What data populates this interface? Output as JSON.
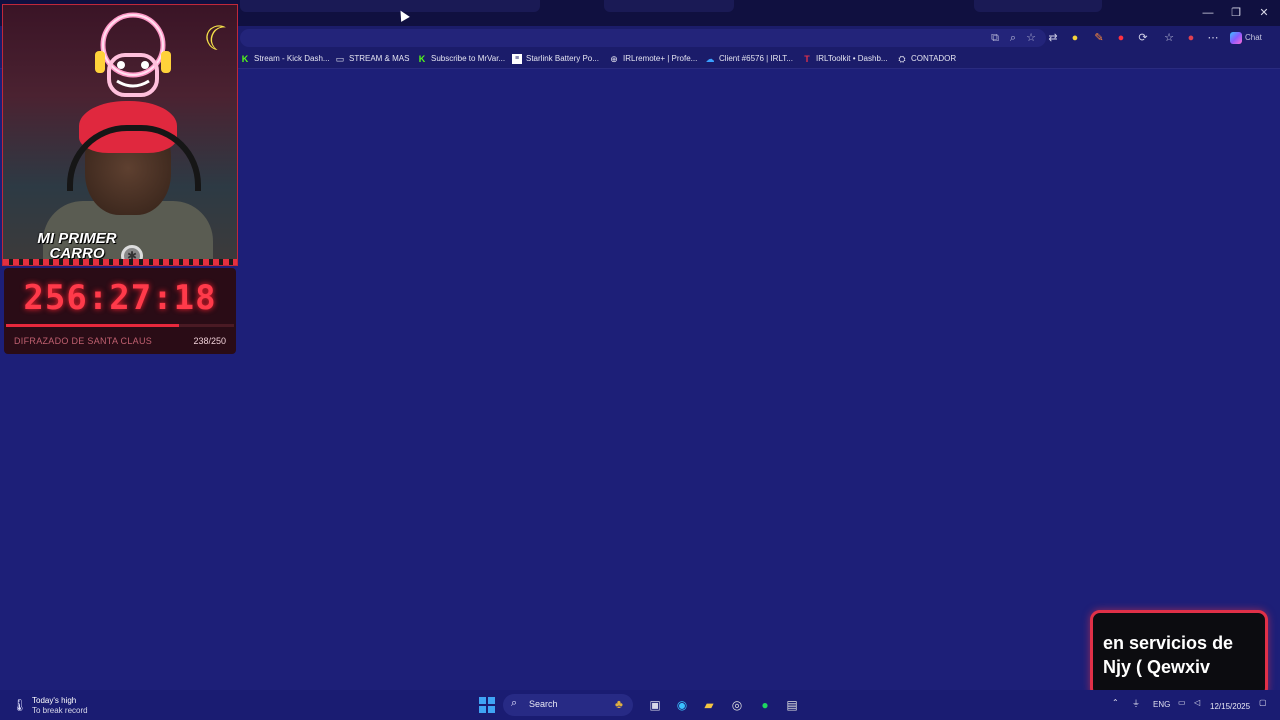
{
  "window": {
    "minimize": "—",
    "restore": "❐",
    "close": "✕"
  },
  "toolbar": {
    "chat_label": "Chat"
  },
  "bookmarks": [
    {
      "label": "Stream - Kick Dash...",
      "icon": "kick-icon",
      "color": "#53fc18"
    },
    {
      "label": "STREAM & MAS",
      "icon": "folder-icon",
      "color": "#c8c8e0"
    },
    {
      "label": "Subscribe to MrVar...",
      "icon": "kick-icon",
      "color": "#53fc18"
    },
    {
      "label": "Starlink Battery Po...",
      "icon": "page-icon",
      "color": "#ffffff"
    },
    {
      "label": "IRLremote+ | Profe...",
      "icon": "globe-icon",
      "color": "#d0d0e8"
    },
    {
      "label": "Client #6576 | IRLT...",
      "icon": "cloud-icon",
      "color": "#3aa0ff"
    },
    {
      "label": "IRLToolkit • Dashb...",
      "icon": "toolkit-icon",
      "color": "#e0304a"
    },
    {
      "label": "CONTADOR",
      "icon": "contador-icon",
      "color": "#f0f0f0"
    }
  ],
  "overlay": {
    "webcam_title_line1": "MI PRIMER",
    "webcam_title_line2": "CARRO",
    "timer": "256:27:18",
    "goal_label": "DIFRAZADO DE SANTA CLAUS",
    "goal_count": "238/250",
    "goal_progress": 0.76,
    "accent_color": "#ff3a4a"
  },
  "captions": {
    "line1": "en servicios de",
    "line2": "Njy (  Qewxiv"
  },
  "taskbar": {
    "weather_line1": "Today's high",
    "weather_line2": "To break record",
    "search_label": "Search",
    "language": "ENG",
    "date": "12/15/2025"
  }
}
